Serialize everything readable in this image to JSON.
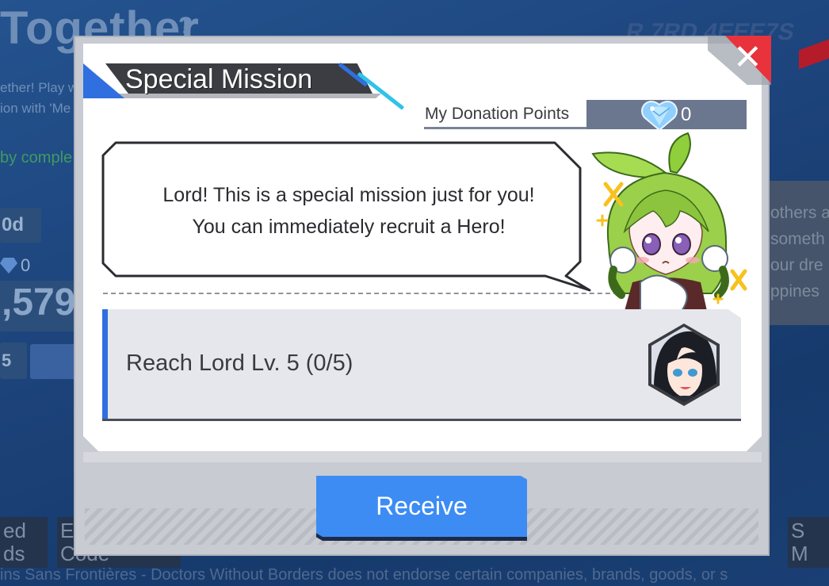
{
  "background": {
    "title": "Together",
    "help": "?",
    "desc_lines": "ether! Play w\nion with 'Me",
    "green_text": "by comple",
    "chip_days": "0d",
    "points": "0",
    "big_number": ",579",
    "small_chip": "5",
    "right_panel_text": "others a\nsometh\nour dre\nppines",
    "bottom_left_text": "ed\nds",
    "bottom_mid_text": "E\nCode",
    "bottom_right_text": "S\nM",
    "footer": "ins Sans Frontières - Doctors Without Borders does not endorse certain companies, brands, goods, or s",
    "topright_text": "R 7RD 4EEE7S"
  },
  "modal": {
    "title": "Special Mission",
    "close_symbol": "✕",
    "donation": {
      "label": "My Donation Points",
      "value": "0",
      "icon": "diamond-icon"
    },
    "speech_lines": [
      "Lord! This is a special mission just for you!",
      "You can immediately recruit a Hero!"
    ],
    "mission": {
      "text": "Reach Lord Lv. 5 (0/5)",
      "reward_icon": "hero-portrait"
    },
    "receive_label": "Receive"
  },
  "colors": {
    "accent_blue": "#3c8cf4",
    "title_blue": "#2f6fe0",
    "close_red": "#e8323c",
    "ribbon_dark": "#3c3d42"
  }
}
